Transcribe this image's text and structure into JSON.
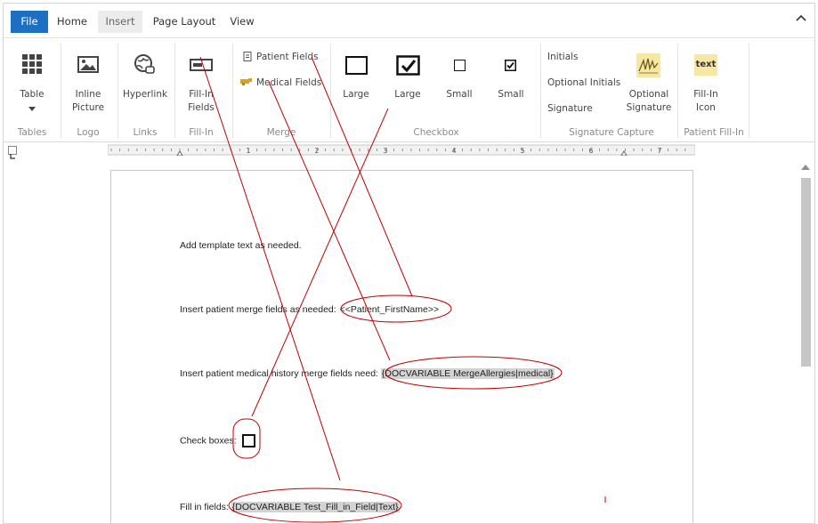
{
  "tabs": {
    "file": "File",
    "home": "Home",
    "insert": "Insert",
    "page_layout": "Page Layout",
    "view": "View"
  },
  "ribbon": {
    "tables": {
      "button": "Table",
      "group": "Tables"
    },
    "logo": {
      "button_line1": "Inline",
      "button_line2": "Picture",
      "group": "Logo"
    },
    "links": {
      "button": "Hyperlink",
      "group": "Links"
    },
    "fillin": {
      "button_line1": "Fill-In",
      "button_line2": "Fields",
      "group": "Fill-In"
    },
    "merge": {
      "patient_fields": "Patient Fields",
      "medical_fields": "Medical Fields",
      "group": "Merge"
    },
    "checkbox": {
      "large1": "Large",
      "large2": "Large",
      "small1": "Small",
      "small2": "Small",
      "group": "Checkbox"
    },
    "signature": {
      "initials": "Initials",
      "optional_initials": "Optional Initials",
      "signature": "Signature",
      "optional_sig_line1": "Optional",
      "optional_sig_line2": "Signature",
      "group": "Signature Capture"
    },
    "patient_fillin": {
      "icon_text": "text",
      "button_line1": "Fill-In",
      "button_line2": "Icon",
      "group": "Patient Fill-In"
    }
  },
  "ruler": {
    "numbers": [
      "1",
      "2",
      "3",
      "4",
      "5",
      "6",
      "7"
    ]
  },
  "document": {
    "line1": "Add template text as needed.",
    "line2_label": "Insert patient merge fields as needed: ",
    "line2_field": "<<Patient_FirstName>>",
    "line3_label": "Insert patient medical history merge fields need: ",
    "line3_field": "{DOCVARIABLE MergeAllergies|medical}",
    "line4_label": "Check boxes: ",
    "line5_label": "Fill in fields: ",
    "line5_field": "{DOCVARIABLE Test_Fill_in_Field|Text}"
  },
  "colors": {
    "accent": "#1c6fc2",
    "annotation": "#c00000",
    "field_bg": "#d3d3d3"
  }
}
